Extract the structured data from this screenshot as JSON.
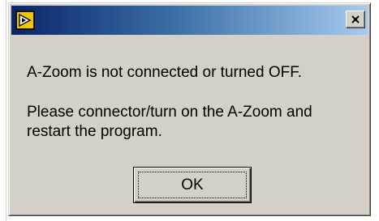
{
  "dialog": {
    "title": "",
    "icon": "labview-run-arrow-icon",
    "close_glyph": "×",
    "message_line_1": "A-Zoom is not connected or turned OFF.",
    "message_line_2": "Please connector/turn on the A-Zoom and",
    "message_line_3": "restart the program.",
    "ok_label": "OK"
  },
  "colors": {
    "face": "#d4d0c8",
    "title_start": "#0a246a",
    "title_end": "#a6caf0",
    "icon_yellow": "#f0c800"
  }
}
